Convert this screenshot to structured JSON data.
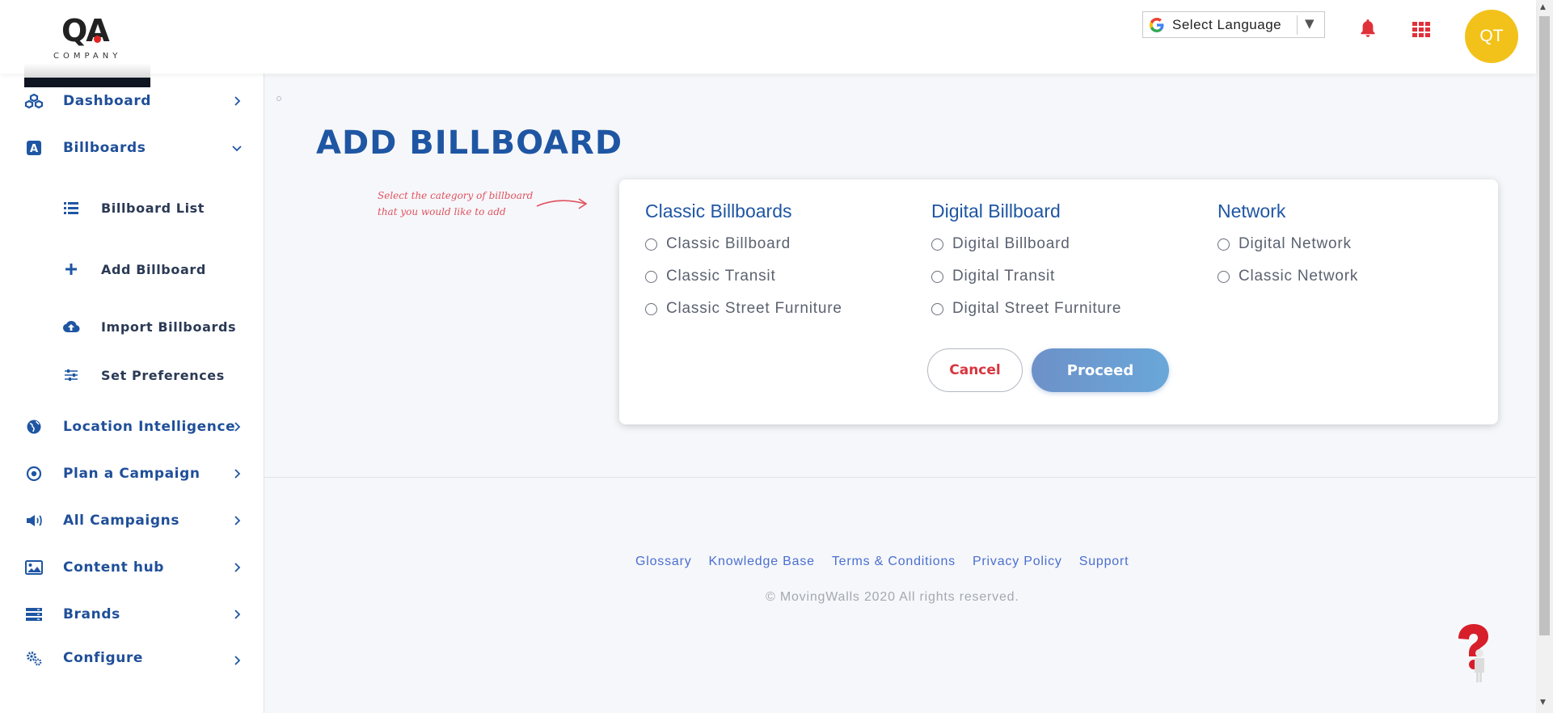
{
  "header": {
    "logo_mark": "QA",
    "logo_sub": "COMPANY",
    "language_label": "Select Language",
    "avatar_initials": "QT"
  },
  "sidebar": {
    "items": [
      {
        "label": "Dashboard",
        "icon": "cubes-icon"
      },
      {
        "label": "Billboards",
        "icon": "billboard-a-icon"
      },
      {
        "label": "Location Intelligence",
        "icon": "globe-icon"
      },
      {
        "label": "Plan a Campaign",
        "icon": "target-icon"
      },
      {
        "label": "All Campaigns",
        "icon": "megaphone-icon"
      },
      {
        "label": "Content hub",
        "icon": "image-icon"
      },
      {
        "label": "Brands",
        "icon": "server-icon"
      },
      {
        "label": "Configure",
        "icon": "gears-icon"
      }
    ],
    "billboard_subitems": [
      {
        "label": "Billboard List",
        "icon": "list-icon"
      },
      {
        "label": "Add Billboard",
        "icon": "plus-icon"
      },
      {
        "label": "Import Billboards",
        "icon": "cloud-upload-icon"
      },
      {
        "label": "Set Preferences",
        "icon": "sliders-icon"
      }
    ]
  },
  "main": {
    "title": "ADD BILLBOARD",
    "hint_line1": "Select the category of billboard",
    "hint_line2": "that you would like to add",
    "columns": [
      {
        "title": "Classic Billboards",
        "options": [
          "Classic Billboard",
          "Classic Transit",
          "Classic Street Furniture"
        ]
      },
      {
        "title": "Digital Billboard",
        "options": [
          "Digital Billboard",
          "Digital Transit",
          "Digital Street Furniture"
        ]
      },
      {
        "title": "Network",
        "options": [
          "Digital Network",
          "Classic Network"
        ]
      }
    ],
    "cancel_label": "Cancel",
    "proceed_label": "Proceed"
  },
  "footer": {
    "links": [
      "Glossary",
      "Knowledge Base",
      "Terms & Conditions",
      "Privacy Policy",
      "Support"
    ],
    "copyright": "© MovingWalls 2020 All rights reserved."
  },
  "colors": {
    "brand_blue": "#1f56a3",
    "accent_red": "#e02424",
    "avatar_yellow": "#f2c21b",
    "proceed_gradient_start": "#6d91c9",
    "proceed_gradient_end": "#6aa7d9"
  }
}
